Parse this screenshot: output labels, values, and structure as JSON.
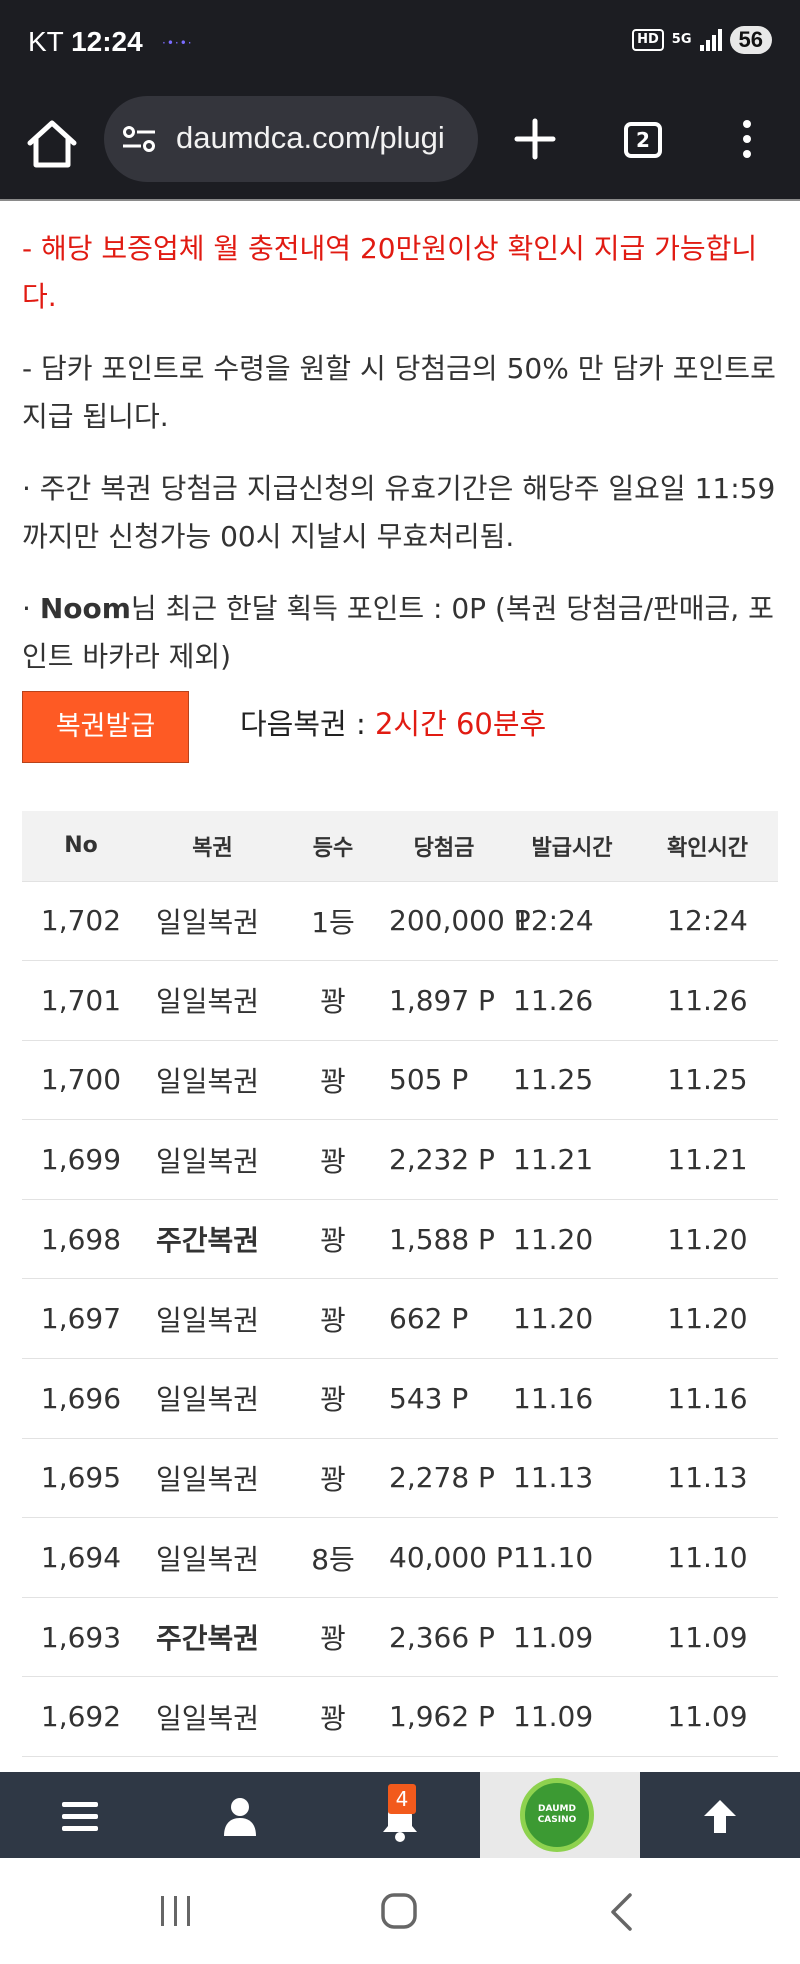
{
  "status_bar": {
    "carrier": "KT",
    "time": "12:24",
    "notification_dots": "·•·•·",
    "hd_label": "HD",
    "network_label": "5G",
    "battery": "56"
  },
  "browser": {
    "url": "daumdca.com/plugi",
    "tab_count": "2"
  },
  "notices": [
    "  - 해당 보증업체 월 충전내역 20만원이상 확인시 지급 가능합니다.",
    "  - 담카 포인트로 수령을 원할 시 당첨금의 50% 만 담카 포인트로 지급 됩니다.",
    " · 주간 복권 당첨금 지급신청의 유효기간은 해당주 일요일 11:59까지만 신청가능 00시 지날시 무효처리됨."
  ],
  "points_notice": {
    "prefix": " · ",
    "user": "Noom",
    "text": "님 최근 한달 획득 포인트 : 0P (복권 당첨금/판매금, 포인트 바카라 제외)"
  },
  "issue_button": "복권발급",
  "next_lottery": {
    "label": "다음복권 : ",
    "value": "2시간 60분후"
  },
  "table": {
    "headers": [
      "No",
      "복권",
      "등수",
      "당첨금",
      "발급시간",
      "확인시간"
    ],
    "rows": [
      {
        "no": "1,702",
        "type": "일일복권",
        "bold": false,
        "rank": "1등",
        "prize": "200,000 P",
        "issued": "12:24",
        "checked": "12:24"
      },
      {
        "no": "1,701",
        "type": "일일복권",
        "bold": false,
        "rank": "꽝",
        "prize": "1,897 P",
        "issued": "11.26",
        "checked": "11.26"
      },
      {
        "no": "1,700",
        "type": "일일복권",
        "bold": false,
        "rank": "꽝",
        "prize": "505 P",
        "issued": "11.25",
        "checked": "11.25"
      },
      {
        "no": "1,699",
        "type": "일일복권",
        "bold": false,
        "rank": "꽝",
        "prize": "2,232 P",
        "issued": "11.21",
        "checked": "11.21"
      },
      {
        "no": "1,698",
        "type": "주간복권",
        "bold": true,
        "rank": "꽝",
        "prize": "1,588 P",
        "issued": "11.20",
        "checked": "11.20"
      },
      {
        "no": "1,697",
        "type": "일일복권",
        "bold": false,
        "rank": "꽝",
        "prize": "662 P",
        "issued": "11.20",
        "checked": "11.20"
      },
      {
        "no": "1,696",
        "type": "일일복권",
        "bold": false,
        "rank": "꽝",
        "prize": "543 P",
        "issued": "11.16",
        "checked": "11.16"
      },
      {
        "no": "1,695",
        "type": "일일복권",
        "bold": false,
        "rank": "꽝",
        "prize": "2,278 P",
        "issued": "11.13",
        "checked": "11.13"
      },
      {
        "no": "1,694",
        "type": "일일복권",
        "bold": false,
        "rank": "8등",
        "prize": "40,000 P",
        "issued": "11.10",
        "checked": "11.10"
      },
      {
        "no": "1,693",
        "type": "주간복권",
        "bold": true,
        "rank": "꽝",
        "prize": "2,366 P",
        "issued": "11.09",
        "checked": "11.09"
      },
      {
        "no": "1,692",
        "type": "일일복권",
        "bold": false,
        "rank": "꽝",
        "prize": "1,962 P",
        "issued": "11.09",
        "checked": "11.09"
      }
    ]
  },
  "bottom_nav": {
    "items": [
      {
        "name": "menu",
        "icon": "hamburger-icon"
      },
      {
        "name": "profile",
        "icon": "user-icon"
      },
      {
        "name": "notifications",
        "icon": "bell-icon"
      },
      {
        "name": "home-logo",
        "icon": "daumd-casino-logo"
      },
      {
        "name": "scroll-top",
        "icon": "arrow-up-icon"
      }
    ],
    "notification_count": "4",
    "logo_text_line1": "DAUMD",
    "logo_text_line2": "CASINO"
  },
  "colors": {
    "accent_orange": "#fe5a24",
    "warning_red": "#e11b12",
    "nav_bg": "#2f3845",
    "chrome_bg": "#1c1d22"
  }
}
